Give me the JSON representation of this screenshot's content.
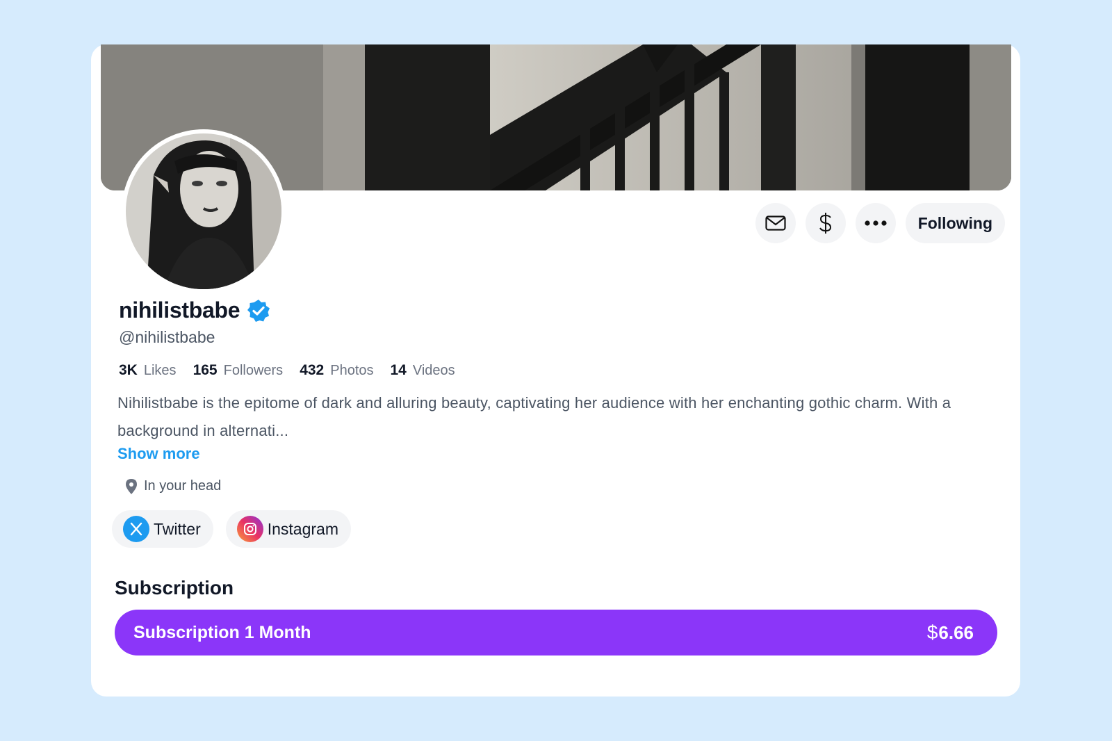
{
  "profile": {
    "display_name": "nihilistbabe",
    "handle": "@nihilistbabe",
    "verified": true,
    "bio": "Nihilistbabe is the epitome of dark and alluring beauty, captivating her audience with her enchanting gothic charm. With a background in alternati...",
    "show_more_label": "Show more",
    "location": "In your head"
  },
  "actions": {
    "message_icon": "envelope-icon",
    "tip_icon": "dollar-icon",
    "more_icon": "more-dots-icon",
    "following_label": "Following"
  },
  "stats": [
    {
      "value": "3K",
      "label": "Likes"
    },
    {
      "value": "165",
      "label": "Followers"
    },
    {
      "value": "432",
      "label": "Photos"
    },
    {
      "value": "14",
      "label": "Videos"
    }
  ],
  "socials": [
    {
      "label": "Twitter",
      "icon": "x-twitter-icon"
    },
    {
      "label": "Instagram",
      "icon": "instagram-icon"
    }
  ],
  "subscription": {
    "heading": "Subscription",
    "plan_label": "Subscription 1 Month",
    "currency": "$",
    "price": "6.66"
  },
  "colors": {
    "page_bg": "#d6ebfd",
    "accent_purple": "#8b36f9",
    "link_blue": "#1d9bf0",
    "verified_blue": "#1d9bf0"
  }
}
